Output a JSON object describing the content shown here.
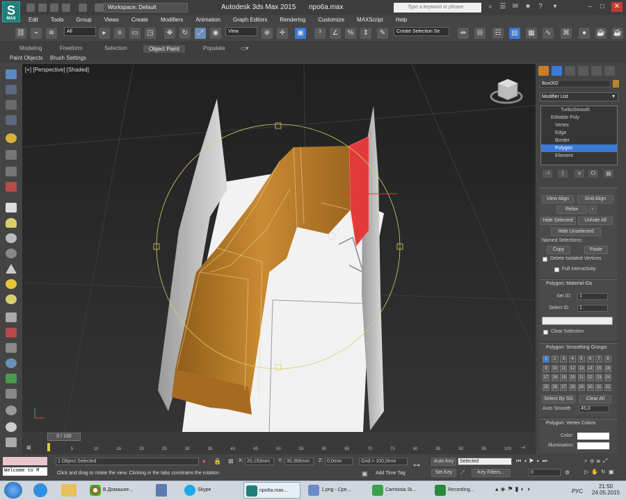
{
  "titlebar": {
    "app_icon_text": "MAX",
    "workspace": "Workspace: Default",
    "title": "Autodesk 3ds Max  2015",
    "document": "npo6a.max",
    "search_placeholder": "Type a keyword or phrase"
  },
  "menu": [
    "Edit",
    "Tools",
    "Group",
    "Views",
    "Create",
    "Modifiers",
    "Animation",
    "Graph Editors",
    "Rendering",
    "Customize",
    "MAXScript",
    "Help"
  ],
  "toolbar": {
    "selection_filter": "All",
    "reference_coord": "View",
    "selection_set": "Create Selection Se"
  },
  "ribbon": {
    "tabs": [
      "Modeling",
      "Freeform",
      "Selection",
      "Object Paint",
      "Populate"
    ],
    "active_tab": "Object Paint",
    "subtabs": [
      "Paint Objects",
      "Brush Settings"
    ]
  },
  "viewport": {
    "label": "[+] [Perspective] [Shaded]",
    "selection_color": "#ff2a2a",
    "object_color": "#c8832a"
  },
  "command_panel": {
    "object_name": "Box002",
    "object_color": "#b8842c",
    "modifier_list": "Modifier List",
    "stack": [
      {
        "label": "TurboSmooth",
        "level": 0
      },
      {
        "label": "Editable Poly",
        "level": 0
      },
      {
        "label": "Vertex",
        "level": 1
      },
      {
        "label": "Edge",
        "level": 1
      },
      {
        "label": "Border",
        "level": 1
      },
      {
        "label": "Polygon",
        "level": 1,
        "selected": true
      },
      {
        "label": "Element",
        "level": 1
      }
    ],
    "edit_geometry": {
      "view_align": "View Align",
      "grid_align": "Grid Align",
      "relax": "Relax",
      "hide_selected": "Hide Selected",
      "unhide_all": "Unhide All",
      "hide_unselected": "Hide Unselected",
      "named_selections": "Named Selections:",
      "copy": "Copy",
      "paste": "Paste",
      "delete_isolated": "Delete Isolated Vertices",
      "full_interactivity": "Full Interactivity"
    },
    "material_ids": {
      "title": "Polygon: Material IDs",
      "set_id_label": "Set ID:",
      "set_id_value": "1",
      "select_id_label": "Select ID",
      "select_id_value": "1",
      "clear_selection": "Clear Selection"
    },
    "smoothing_groups": {
      "title": "Polygon: Smoothing Groups",
      "groups": [
        "1",
        "2",
        "3",
        "4",
        "5",
        "6",
        "7",
        "8",
        "9",
        "10",
        "11",
        "12",
        "13",
        "14",
        "15",
        "16",
        "17",
        "18",
        "19",
        "20",
        "21",
        "22",
        "23",
        "24",
        "25",
        "26",
        "27",
        "28",
        "29",
        "30",
        "31",
        "32"
      ],
      "selected": [
        "1"
      ],
      "select_by_sg": "Select By SG",
      "clear_all": "Clear All",
      "auto_smooth": "Auto Smooth",
      "auto_smooth_value": "45,0"
    },
    "vertex_colors": {
      "title": "Polygon: Vertex Colors",
      "color_label": "Color:",
      "illumination_label": "Illumination:"
    }
  },
  "timeline": {
    "frame": "0 / 100",
    "ticks": [
      "0",
      "5",
      "10",
      "15",
      "20",
      "25",
      "30",
      "35",
      "40",
      "45",
      "50",
      "55",
      "60",
      "65",
      "70",
      "75",
      "80",
      "85",
      "90",
      "95",
      "100"
    ]
  },
  "status": {
    "welcome": "Welcome to M",
    "selected": "1 Object Selected",
    "prompt": "Click and drag to rotate the view.  Clicking in the tabs constrains the rotation",
    "x": "20,153mm",
    "y": "30,366mm",
    "z": "0,0mm",
    "grid": "Grid = 100,0mm",
    "add_time_tag": "Add Time Tag",
    "auto_key": "Auto Key",
    "key_mode": "Selected",
    "set_key": "Set Key",
    "key_filters": "Key Filters...",
    "current_frame": "0"
  },
  "taskbar": {
    "items": [
      "В Домашне...",
      "Skype",
      "npo6a.max...",
      "1.png - Сре...",
      "Camtasia St...",
      "Recording..."
    ],
    "lang": "РУС",
    "time": "21:50",
    "date": "24.05.2015"
  }
}
